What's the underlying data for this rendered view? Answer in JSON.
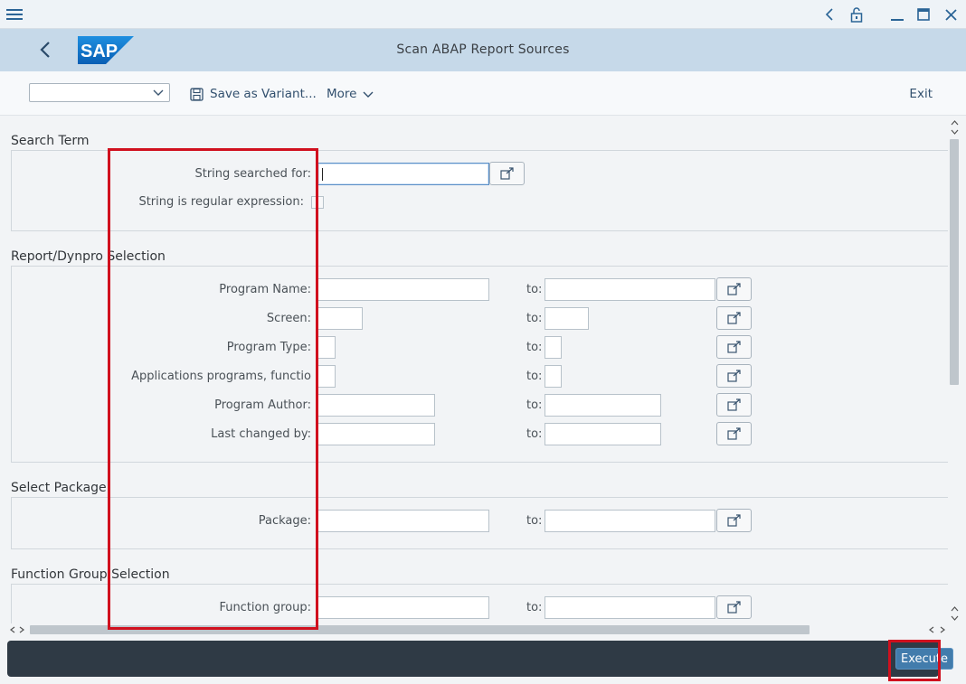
{
  "window": {
    "title": "Scan ABAP Report Sources",
    "brand": "SAP"
  },
  "toolbar": {
    "variant_value": "",
    "save_variant": "Save as Variant...",
    "more": "More",
    "exit": "Exit"
  },
  "sections": {
    "search_term": {
      "title": "Search Term",
      "string_label": "String searched for:",
      "string_value": "",
      "regex_label": "String is regular expression:",
      "regex_checked": false
    },
    "report_dynpro": {
      "title": "Report/Dynpro Selection",
      "rows": [
        {
          "label": "Program Name:",
          "to": "to:"
        },
        {
          "label": "Screen:",
          "to": "to:"
        },
        {
          "label": "Program Type:",
          "to": "to:"
        },
        {
          "label": "Applications programs, functio",
          "to": "to:"
        },
        {
          "label": "Program Author:",
          "to": "to:"
        },
        {
          "label": "Last changed by:",
          "to": "to:"
        }
      ]
    },
    "package": {
      "title": "Select Package",
      "label": "Package:",
      "to": "to:"
    },
    "function_group": {
      "title": "Function Group Selection",
      "label": "Function group:",
      "to": "to:"
    }
  },
  "footer": {
    "execute": "Execute"
  },
  "colors": {
    "shell_bar": "#c6d9e9",
    "footer": "#2f3a45",
    "execute_button": "#427cac",
    "highlight": "#d0101e"
  }
}
